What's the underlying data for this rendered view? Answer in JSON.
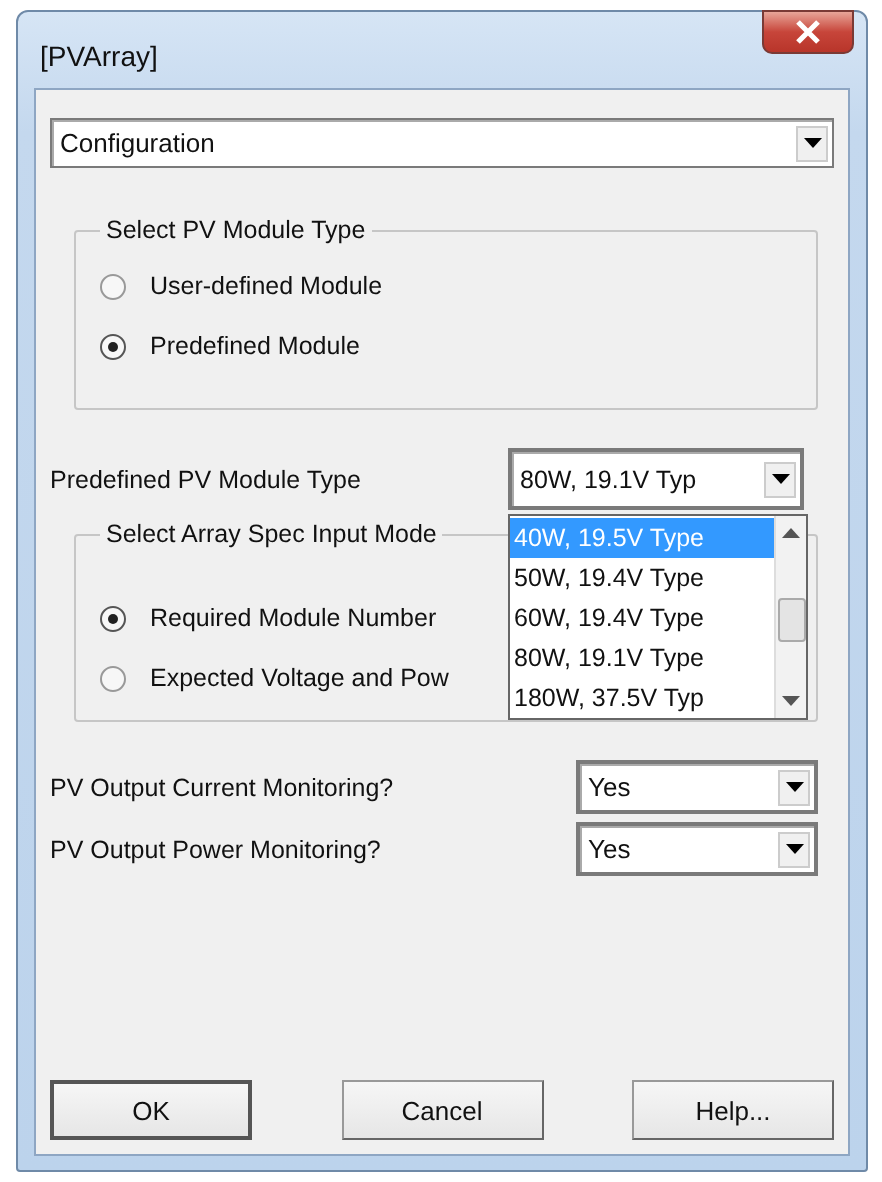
{
  "window": {
    "title": "[PVArray]"
  },
  "page_select": {
    "value": "Configuration"
  },
  "module_type_group": {
    "title": "Select PV Module Type",
    "options": [
      {
        "label": "User-defined Module",
        "selected": false
      },
      {
        "label": "Predefined Module",
        "selected": true
      }
    ]
  },
  "predefined_type": {
    "label": "Predefined PV Module Type",
    "value": "80W, 19.1V Typ",
    "expanded": true,
    "options": [
      {
        "label": "40W, 19.5V Type",
        "selected": true
      },
      {
        "label": "50W, 19.4V Type",
        "selected": false
      },
      {
        "label": "60W, 19.4V Type",
        "selected": false
      },
      {
        "label": "80W, 19.1V Type",
        "selected": false
      },
      {
        "label": "180W, 37.5V Typ",
        "selected": false
      }
    ]
  },
  "array_spec_group": {
    "title": "Select Array Spec Input Mode",
    "options": [
      {
        "label": "Required Module Number",
        "selected": true
      },
      {
        "label": "Expected Voltage and Pow",
        "selected": false
      }
    ]
  },
  "monitoring": [
    {
      "label": "PV Output Current Monitoring?",
      "value": "Yes"
    },
    {
      "label": "PV Output Power Monitoring?",
      "value": "Yes"
    }
  ],
  "buttons": [
    "OK",
    "Cancel",
    "Help..."
  ]
}
